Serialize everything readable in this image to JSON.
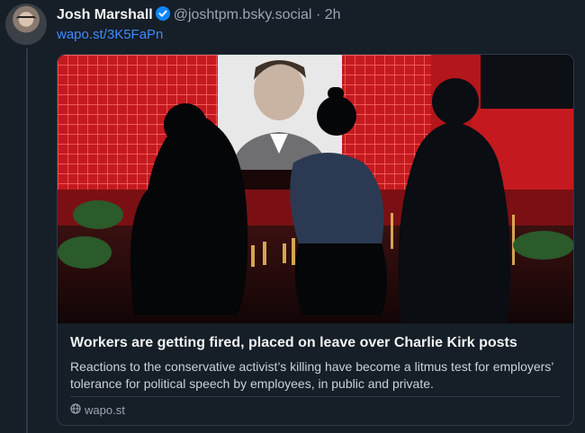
{
  "post": {
    "author_name": "Josh Marshall",
    "handle": "@joshtpm.bsky.social",
    "separator": "·",
    "time": "2h",
    "link_text": "wapo.st/3K5FaPn"
  },
  "card": {
    "title": "Workers are getting fired, placed on leave over Charlie Kirk posts",
    "description": "Reactions to the conservative activist’s killing have become a litmus test for employers’ tolerance for political speech by employees, in public and private.",
    "domain": "wapo.st"
  },
  "icons": {
    "verified": "verified-badge-icon",
    "globe": "globe-icon"
  },
  "colors": {
    "background": "#161e27",
    "link": "#3d8bfd",
    "verified": "#1185fe",
    "muted": "#9aa7b4"
  }
}
